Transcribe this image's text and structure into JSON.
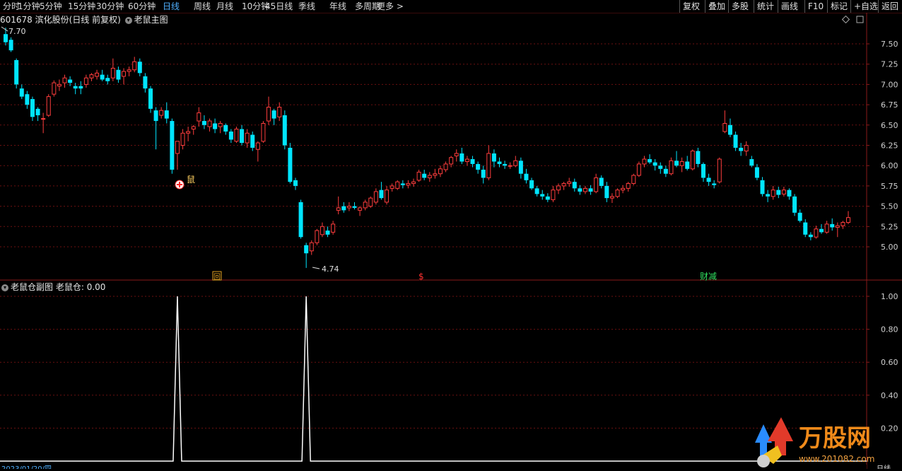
{
  "toolbar": {
    "periods": [
      "分时",
      "1分钟",
      "5分钟",
      "15分钟",
      "30分钟",
      "60分钟",
      "日线",
      "周线",
      "月线",
      "10分钟",
      "45日线",
      "季线",
      "年线",
      "多周期",
      "更多 >"
    ],
    "active_period": "日线",
    "right_buttons": [
      "复权",
      "叠加",
      "多股",
      "统计",
      "画线",
      "F10",
      "标记",
      "+自选",
      "返回"
    ]
  },
  "main_panel": {
    "stock_code": "601678",
    "stock_name": "滨化股份",
    "mode": "(日线 前复权)",
    "indicator": "老鼠主图",
    "high_label": "7.70",
    "low_label": "4.74",
    "signal_label": "鼠",
    "axis_ticks": [
      "7.50",
      "7.25",
      "7.00",
      "6.75",
      "6.50",
      "6.25",
      "6.00",
      "5.75",
      "5.50",
      "5.25",
      "5.00"
    ]
  },
  "sub_panel": {
    "indicator": "老鼠仓副图",
    "value_label": "老鼠仓: 0.00",
    "axis_ticks": [
      "1.00",
      "0.80",
      "0.60",
      "0.40",
      "0.20"
    ]
  },
  "markers": {
    "hui": "回",
    "s": "$",
    "caibao": "财减"
  },
  "footer": {
    "date": "2023/01/20/四",
    "period_label": "日线"
  },
  "watermark": {
    "brand": "万股网",
    "site": "www.201082.com"
  },
  "colors": {
    "up": "#ff3d3d",
    "down": "#00e5ff",
    "grid": "#6b1010",
    "axis_text": "#d0d0d0",
    "active_tab": "#4fb0ff"
  },
  "chart_data": {
    "type": "candlestick",
    "ylim": [
      4.74,
      7.7
    ],
    "ohlc": [
      [
        7.62,
        7.7,
        7.48,
        7.52
      ],
      [
        7.55,
        7.58,
        7.4,
        7.42
      ],
      [
        7.3,
        7.32,
        6.95,
        7.0
      ],
      [
        6.95,
        7.0,
        6.82,
        6.85
      ],
      [
        6.88,
        6.92,
        6.7,
        6.75
      ],
      [
        6.82,
        6.85,
        6.55,
        6.6
      ],
      [
        6.7,
        6.72,
        6.55,
        6.62
      ],
      [
        6.58,
        6.65,
        6.4,
        6.58
      ],
      [
        6.62,
        6.88,
        6.6,
        6.85
      ],
      [
        6.88,
        7.05,
        6.85,
        7.02
      ],
      [
        6.98,
        7.06,
        6.92,
        7.0
      ],
      [
        7.02,
        7.12,
        6.96,
        7.08
      ],
      [
        7.06,
        7.1,
        6.98,
        7.02
      ],
      [
        6.98,
        7.02,
        6.88,
        6.95
      ],
      [
        6.98,
        7.04,
        6.88,
        6.95
      ],
      [
        7.0,
        7.12,
        6.96,
        7.08
      ],
      [
        7.08,
        7.14,
        7.04,
        7.12
      ],
      [
        7.1,
        7.18,
        7.06,
        7.14
      ],
      [
        7.12,
        7.18,
        7.04,
        7.06
      ],
      [
        7.08,
        7.12,
        7.0,
        7.04
      ],
      [
        7.08,
        7.32,
        7.04,
        7.2
      ],
      [
        7.18,
        7.22,
        7.02,
        7.06
      ],
      [
        7.1,
        7.2,
        7.0,
        7.16
      ],
      [
        7.16,
        7.22,
        7.1,
        7.18
      ],
      [
        7.18,
        7.34,
        7.15,
        7.28
      ],
      [
        7.28,
        7.32,
        7.1,
        7.14
      ],
      [
        7.1,
        7.14,
        6.9,
        6.95
      ],
      [
        6.95,
        6.98,
        6.65,
        6.7
      ],
      [
        6.68,
        6.72,
        6.2,
        6.55
      ],
      [
        6.62,
        6.72,
        6.58,
        6.68
      ],
      [
        6.68,
        6.78,
        6.52,
        6.58
      ],
      [
        6.55,
        6.58,
        5.9,
        5.95
      ],
      [
        6.15,
        6.2,
        5.95,
        6.3
      ],
      [
        6.25,
        6.45,
        6.2,
        6.4
      ],
      [
        6.4,
        6.48,
        6.3,
        6.42
      ],
      [
        6.45,
        6.5,
        6.38,
        6.48
      ],
      [
        6.55,
        6.72,
        6.48,
        6.65
      ],
      [
        6.55,
        6.62,
        6.45,
        6.5
      ],
      [
        6.48,
        6.58,
        6.42,
        6.55
      ],
      [
        6.52,
        6.58,
        6.4,
        6.45
      ],
      [
        6.48,
        6.55,
        6.4,
        6.52
      ],
      [
        6.5,
        6.52,
        6.38,
        6.42
      ],
      [
        6.42,
        6.45,
        6.28,
        6.32
      ],
      [
        6.3,
        6.48,
        6.28,
        6.45
      ],
      [
        6.45,
        6.5,
        6.25,
        6.28
      ],
      [
        6.28,
        6.45,
        6.22,
        6.4
      ],
      [
        6.38,
        6.42,
        6.18,
        6.22
      ],
      [
        6.2,
        6.3,
        6.05,
        6.28
      ],
      [
        6.3,
        6.55,
        6.28,
        6.52
      ],
      [
        6.55,
        6.85,
        6.5,
        6.72
      ],
      [
        6.68,
        6.7,
        6.5,
        6.58
      ],
      [
        6.6,
        6.78,
        6.55,
        6.72
      ],
      [
        6.62,
        6.68,
        6.2,
        6.25
      ],
      [
        6.22,
        6.28,
        5.78,
        5.8
      ],
      [
        5.82,
        5.85,
        5.7,
        5.75
      ],
      [
        5.55,
        5.58,
        5.1,
        5.12
      ],
      [
        5.02,
        5.05,
        4.74,
        4.92
      ],
      [
        4.95,
        5.08,
        4.9,
        5.05
      ],
      [
        5.05,
        5.22,
        5.02,
        5.2
      ],
      [
        5.15,
        5.3,
        5.12,
        5.25
      ],
      [
        5.2,
        5.25,
        5.12,
        5.15
      ],
      [
        5.18,
        5.32,
        5.15,
        5.28
      ],
      [
        5.45,
        5.62,
        5.4,
        5.48
      ],
      [
        5.5,
        5.55,
        5.42,
        5.45
      ],
      [
        5.48,
        5.55,
        5.44,
        5.5
      ],
      [
        5.5,
        5.55,
        5.46,
        5.48
      ],
      [
        5.45,
        5.5,
        5.38,
        5.48
      ],
      [
        5.48,
        5.58,
        5.45,
        5.55
      ],
      [
        5.5,
        5.62,
        5.48,
        5.6
      ],
      [
        5.55,
        5.72,
        5.52,
        5.68
      ],
      [
        5.7,
        5.8,
        5.58,
        5.6
      ],
      [
        5.55,
        5.75,
        5.52,
        5.7
      ],
      [
        5.72,
        5.78,
        5.68,
        5.75
      ],
      [
        5.72,
        5.82,
        5.7,
        5.8
      ],
      [
        5.78,
        5.82,
        5.72,
        5.76
      ],
      [
        5.76,
        5.82,
        5.72,
        5.78
      ],
      [
        5.78,
        5.84,
        5.74,
        5.8
      ],
      [
        5.82,
        5.95,
        5.8,
        5.92
      ],
      [
        5.9,
        5.95,
        5.82,
        5.85
      ],
      [
        5.85,
        5.92,
        5.8,
        5.88
      ],
      [
        5.88,
        5.96,
        5.84,
        5.9
      ],
      [
        5.9,
        6.0,
        5.86,
        5.96
      ],
      [
        5.95,
        6.05,
        5.92,
        6.02
      ],
      [
        6.02,
        6.12,
        5.98,
        6.1
      ],
      [
        6.12,
        6.2,
        6.05,
        6.15
      ],
      [
        6.15,
        6.22,
        6.02,
        6.05
      ],
      [
        6.05,
        6.12,
        6.0,
        6.08
      ],
      [
        6.08,
        6.12,
        5.98,
        6.02
      ],
      [
        6.02,
        6.05,
        5.9,
        5.95
      ],
      [
        5.95,
        6.0,
        5.78,
        5.85
      ],
      [
        5.85,
        6.25,
        5.82,
        6.15
      ],
      [
        6.15,
        6.2,
        5.98,
        6.05
      ],
      [
        6.05,
        6.1,
        5.98,
        6.02
      ],
      [
        6.02,
        6.06,
        5.96,
        6.0
      ],
      [
        6.0,
        6.04,
        5.96,
        6.0
      ],
      [
        6.0,
        6.12,
        5.98,
        6.06
      ],
      [
        6.06,
        6.1,
        5.84,
        5.9
      ],
      [
        5.9,
        5.96,
        5.78,
        5.82
      ],
      [
        5.82,
        5.85,
        5.7,
        5.72
      ],
      [
        5.72,
        5.75,
        5.62,
        5.65
      ],
      [
        5.65,
        5.7,
        5.58,
        5.62
      ],
      [
        5.62,
        5.66,
        5.55,
        5.58
      ],
      [
        5.58,
        5.75,
        5.55,
        5.7
      ],
      [
        5.7,
        5.78,
        5.65,
        5.75
      ],
      [
        5.75,
        5.8,
        5.7,
        5.78
      ],
      [
        5.78,
        5.85,
        5.74,
        5.8
      ],
      [
        5.8,
        5.84,
        5.68,
        5.72
      ],
      [
        5.72,
        5.76,
        5.64,
        5.68
      ],
      [
        5.68,
        5.75,
        5.65,
        5.72
      ],
      [
        5.72,
        5.76,
        5.64,
        5.68
      ],
      [
        5.68,
        5.9,
        5.66,
        5.85
      ],
      [
        5.85,
        5.88,
        5.72,
        5.75
      ],
      [
        5.75,
        5.8,
        5.55,
        5.6
      ],
      [
        5.6,
        5.66,
        5.54,
        5.62
      ],
      [
        5.62,
        5.72,
        5.6,
        5.7
      ],
      [
        5.7,
        5.76,
        5.66,
        5.72
      ],
      [
        5.72,
        5.8,
        5.68,
        5.78
      ],
      [
        5.78,
        5.9,
        5.76,
        5.88
      ],
      [
        5.88,
        6.05,
        5.86,
        6.02
      ],
      [
        6.02,
        6.12,
        5.98,
        6.08
      ],
      [
        6.08,
        6.14,
        6.02,
        6.04
      ],
      [
        6.04,
        6.08,
        5.94,
        6.0
      ],
      [
        6.0,
        6.04,
        5.9,
        5.96
      ],
      [
        5.96,
        6.0,
        5.86,
        5.9
      ],
      [
        5.9,
        6.1,
        5.88,
        6.06
      ],
      [
        6.06,
        6.18,
        5.98,
        6.0
      ],
      [
        6.0,
        6.1,
        5.92,
        6.05
      ],
      [
        6.05,
        6.12,
        5.94,
        5.96
      ],
      [
        5.96,
        6.2,
        5.94,
        6.18
      ],
      [
        6.18,
        6.22,
        5.98,
        6.02
      ],
      [
        6.02,
        6.04,
        5.8,
        5.85
      ],
      [
        5.85,
        5.9,
        5.75,
        5.8
      ],
      [
        5.78,
        5.82,
        5.72,
        5.76
      ],
      [
        5.8,
        6.1,
        5.78,
        6.08
      ],
      [
        6.42,
        6.68,
        6.4,
        6.52
      ],
      [
        6.5,
        6.58,
        6.35,
        6.38
      ],
      [
        6.38,
        6.42,
        6.18,
        6.22
      ],
      [
        6.22,
        6.28,
        6.12,
        6.18
      ],
      [
        6.18,
        6.3,
        6.12,
        6.25
      ],
      [
        6.08,
        6.12,
        5.98,
        6.0
      ],
      [
        5.98,
        6.02,
        5.82,
        5.85
      ],
      [
        5.82,
        5.86,
        5.62,
        5.65
      ],
      [
        5.65,
        5.7,
        5.55,
        5.62
      ],
      [
        5.62,
        5.75,
        5.58,
        5.7
      ],
      [
        5.7,
        5.74,
        5.6,
        5.64
      ],
      [
        5.65,
        5.74,
        5.62,
        5.7
      ],
      [
        5.7,
        5.72,
        5.58,
        5.62
      ],
      [
        5.62,
        5.65,
        5.38,
        5.42
      ],
      [
        5.42,
        5.46,
        5.3,
        5.32
      ],
      [
        5.3,
        5.34,
        5.12,
        5.15
      ],
      [
        5.15,
        5.18,
        5.08,
        5.12
      ],
      [
        5.12,
        5.26,
        5.1,
        5.22
      ],
      [
        5.22,
        5.28,
        5.16,
        5.18
      ],
      [
        5.18,
        5.32,
        5.16,
        5.28
      ],
      [
        5.28,
        5.35,
        5.2,
        5.24
      ],
      [
        5.24,
        5.3,
        5.12,
        5.26
      ],
      [
        5.26,
        5.32,
        5.22,
        5.3
      ],
      [
        5.3,
        5.44,
        5.28,
        5.36
      ]
    ],
    "sub_series": {
      "name": "老鼠仓",
      "peaks": [
        32,
        56
      ],
      "peak_value": 1.0
    }
  }
}
